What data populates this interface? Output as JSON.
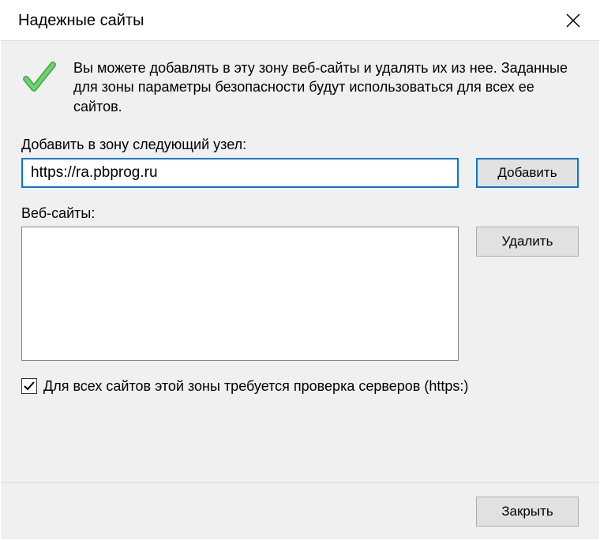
{
  "titlebar": {
    "title": "Надежные сайты"
  },
  "intro": {
    "text": "Вы можете добавлять в эту зону  веб-сайты и удалять их из нее. Заданные для зоны параметры безопасности будут использоваться для всех ее сайтов."
  },
  "add_section": {
    "label": "Добавить в зону следующий узел:",
    "input_value": "https://ra.pbprog.ru",
    "button": "Добавить"
  },
  "sites_section": {
    "label": "Веб-сайты:",
    "remove_button": "Удалить",
    "items": []
  },
  "checkbox": {
    "checked": true,
    "label": "Для всех сайтов этой зоны требуется проверка серверов (https:)"
  },
  "footer": {
    "close_button": "Закрыть"
  }
}
